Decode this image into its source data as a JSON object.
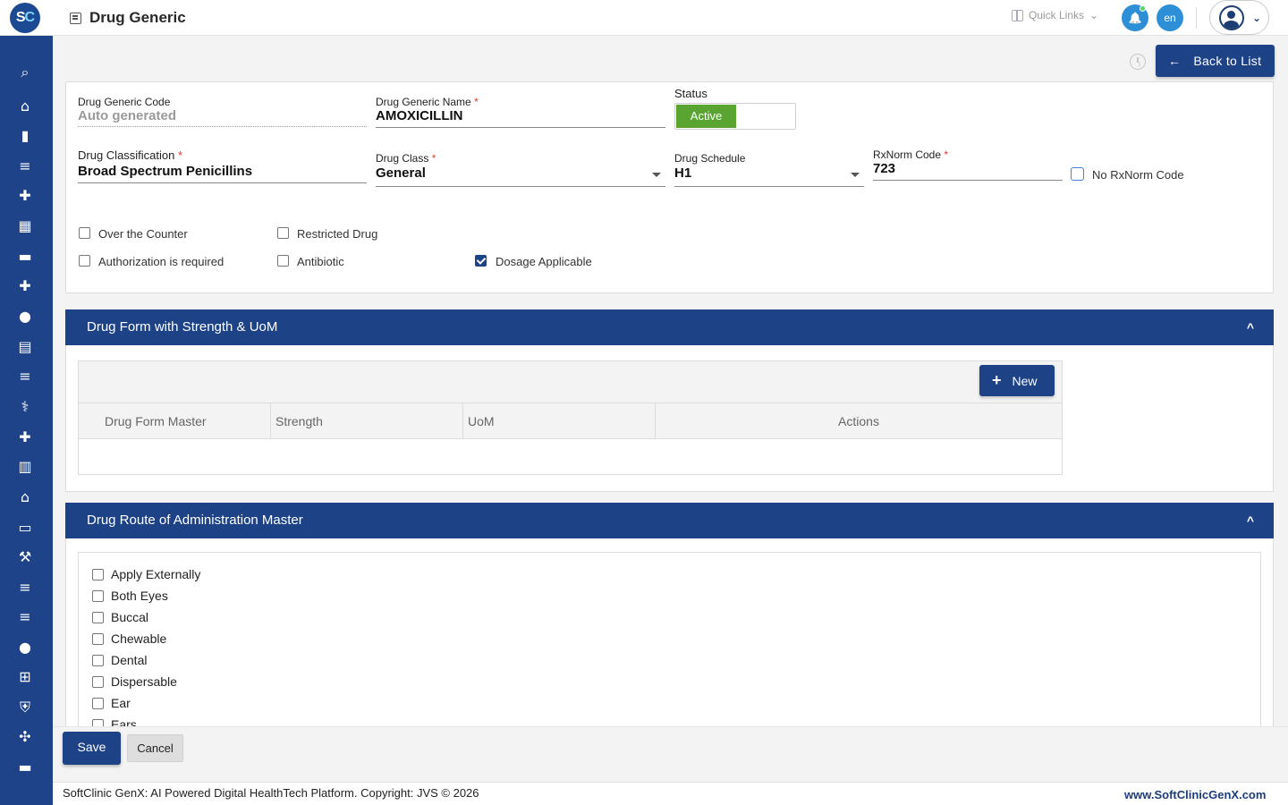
{
  "header": {
    "logo_text_s": "S",
    "logo_text_c": "C",
    "page_title": "Drug Generic",
    "quick_links": "Quick Links",
    "quick_links_caret": "⌄",
    "bell_icon": "🔔",
    "language": "en",
    "user_chevron": "⌄"
  },
  "sidebar": {
    "items": [
      {
        "icon": "search-icon",
        "glyph": "⌕"
      },
      {
        "icon": "home-icon",
        "glyph": "⌂"
      },
      {
        "icon": "bar-chart-icon",
        "glyph": "▮"
      },
      {
        "icon": "menu-icon",
        "glyph": "≡"
      },
      {
        "icon": "medical-bag-icon",
        "glyph": "✚"
      },
      {
        "icon": "calendar-icon",
        "glyph": "▦"
      },
      {
        "icon": "bed-icon",
        "glyph": "▬"
      },
      {
        "icon": "hospital-plus-icon",
        "glyph": "✚"
      },
      {
        "icon": "person-icon",
        "glyph": "●"
      },
      {
        "icon": "document-icon",
        "glyph": "▤"
      },
      {
        "icon": "list-icon",
        "glyph": "≡"
      },
      {
        "icon": "pharmacy-icon",
        "glyph": "⚕"
      },
      {
        "icon": "medicine-bottle-icon",
        "glyph": "✚"
      },
      {
        "icon": "book-icon",
        "glyph": "▥"
      },
      {
        "icon": "store-icon",
        "glyph": "⌂"
      },
      {
        "icon": "devices-icon",
        "glyph": "▭"
      },
      {
        "icon": "wrench-icon",
        "glyph": "⚒"
      },
      {
        "icon": "list-alt-icon",
        "glyph": "≡"
      },
      {
        "icon": "list-lines-icon",
        "glyph": "≡"
      },
      {
        "icon": "drop-icon",
        "glyph": "●"
      },
      {
        "icon": "add-box-icon",
        "glyph": "⊞"
      },
      {
        "icon": "shield-icon",
        "glyph": "⛨"
      },
      {
        "icon": "network-icon",
        "glyph": "✣"
      },
      {
        "icon": "folder-icon",
        "glyph": "▬"
      }
    ]
  },
  "toolbar": {
    "back_arrow": "←",
    "back_label": "Back to List"
  },
  "form": {
    "code_label": "Drug Generic Code",
    "code_value": "Auto generated",
    "name_label": "Drug Generic Name",
    "name_value": "AMOXICILLIN",
    "status_label": "Status",
    "status_value": "Active",
    "classification_label": "Drug Classification",
    "classification_value": "Broad Spectrum Penicillins",
    "class_label": "Drug Class",
    "class_value": "General",
    "schedule_label": "Drug Schedule",
    "schedule_value": "H1",
    "rxnorm_label": "RxNorm Code",
    "rxnorm_value": "723",
    "no_rxnorm_label": "No RxNorm Code",
    "required_mark": "*",
    "checkboxes": {
      "otc": "Over the Counter",
      "auth": "Authorization is required",
      "restricted": "Restricted Drug",
      "antibiotic": "Antibiotic",
      "dosage": "Dosage Applicable"
    }
  },
  "drug_form_section": {
    "title": "Drug Form with Strength & UoM",
    "chevron": "^",
    "new_plus": "+",
    "new_label": "New",
    "columns": [
      "Drug Form Master",
      "Strength",
      "UoM",
      "Actions"
    ]
  },
  "route_section": {
    "title": "Drug Route of Administration Master",
    "chevron": "^",
    "items": [
      "Apply Externally",
      "Both Eyes",
      "Buccal",
      "Chewable",
      "Dental",
      "Dispersable",
      "Ear",
      "Ears"
    ]
  },
  "actions": {
    "save": "Save",
    "cancel": "Cancel"
  },
  "footer": {
    "copyright": "SoftClinic GenX: AI Powered Digital HealthTech Platform. Copyright: JVS © 2026",
    "website": "www.SoftClinicGenX.com"
  },
  "colors": {
    "primary": "#1d4286",
    "active_green": "#5aa532",
    "accent_blue": "#2d8fd5"
  }
}
